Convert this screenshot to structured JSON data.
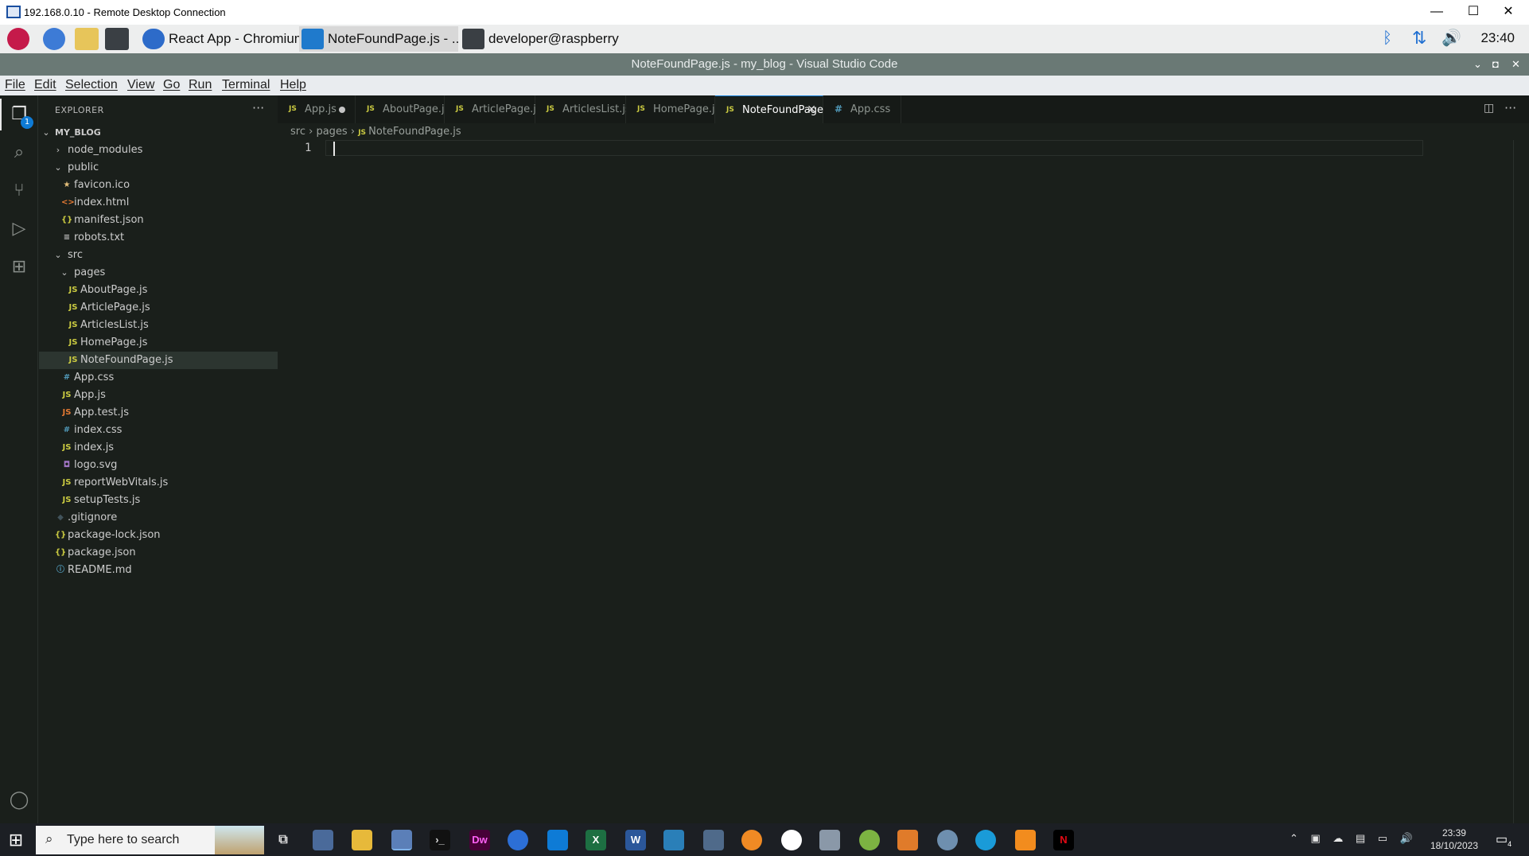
{
  "rdp": {
    "title": "192.168.0.10 - Remote Desktop Connection",
    "minimize": "—",
    "maximize": "☐",
    "close": "✕"
  },
  "pi_taskbar": {
    "tasks": [
      {
        "label": "React App - Chromium",
        "icon": "chromium-icon"
      },
      {
        "label": "NoteFoundPage.js - ...",
        "icon": "vscode-icon"
      },
      {
        "label": "developer@raspberry...",
        "icon": "terminal-icon"
      }
    ],
    "clock": "23:40"
  },
  "vscode": {
    "window_title": "NoteFoundPage.js - my_blog - Visual Studio Code",
    "menu": [
      "File",
      "Edit",
      "Selection",
      "View",
      "Go",
      "Run",
      "Terminal",
      "Help"
    ],
    "explorer_label": "EXPLORER",
    "explorer_more": "···",
    "source_control_badge": "1",
    "project": "MY_BLOG",
    "tree": [
      {
        "label": "node_modules",
        "depth": 1,
        "kind": "folder",
        "open": false
      },
      {
        "label": "public",
        "depth": 1,
        "kind": "folder",
        "open": true
      },
      {
        "label": "favicon.ico",
        "depth": 2,
        "kind": "file",
        "icon": "★",
        "color": "#e5c07b"
      },
      {
        "label": "index.html",
        "depth": 2,
        "kind": "file",
        "icon": "<>",
        "color": "#e37933"
      },
      {
        "label": "manifest.json",
        "depth": 2,
        "kind": "file",
        "icon": "{}",
        "color": "#cbcb41"
      },
      {
        "label": "robots.txt",
        "depth": 2,
        "kind": "file",
        "icon": "≡",
        "color": "#c5c5c5"
      },
      {
        "label": "src",
        "depth": 1,
        "kind": "folder",
        "open": true
      },
      {
        "label": "pages",
        "depth": 2,
        "kind": "folder",
        "open": true
      },
      {
        "label": "AboutPage.js",
        "depth": 3,
        "kind": "file",
        "icon": "JS",
        "color": "#cbcb41"
      },
      {
        "label": "ArticlePage.js",
        "depth": 3,
        "kind": "file",
        "icon": "JS",
        "color": "#cbcb41"
      },
      {
        "label": "ArticlesList.js",
        "depth": 3,
        "kind": "file",
        "icon": "JS",
        "color": "#cbcb41"
      },
      {
        "label": "HomePage.js",
        "depth": 3,
        "kind": "file",
        "icon": "JS",
        "color": "#cbcb41"
      },
      {
        "label": "NoteFoundPage.js",
        "depth": 3,
        "kind": "file",
        "icon": "JS",
        "color": "#cbcb41",
        "selected": true
      },
      {
        "label": "App.css",
        "depth": 2,
        "kind": "file",
        "icon": "#",
        "color": "#519aba"
      },
      {
        "label": "App.js",
        "depth": 2,
        "kind": "file",
        "icon": "JS",
        "color": "#cbcb41"
      },
      {
        "label": "App.test.js",
        "depth": 2,
        "kind": "file",
        "icon": "JS",
        "color": "#e37933"
      },
      {
        "label": "index.css",
        "depth": 2,
        "kind": "file",
        "icon": "#",
        "color": "#519aba"
      },
      {
        "label": "index.js",
        "depth": 2,
        "kind": "file",
        "icon": "JS",
        "color": "#cbcb41"
      },
      {
        "label": "logo.svg",
        "depth": 2,
        "kind": "file",
        "icon": "◘",
        "color": "#a074c4"
      },
      {
        "label": "reportWebVitals.js",
        "depth": 2,
        "kind": "file",
        "icon": "JS",
        "color": "#cbcb41"
      },
      {
        "label": "setupTests.js",
        "depth": 2,
        "kind": "file",
        "icon": "JS",
        "color": "#cbcb41"
      },
      {
        "label": ".gitignore",
        "depth": 1,
        "kind": "file",
        "icon": "◆",
        "color": "#41535b"
      },
      {
        "label": "package-lock.json",
        "depth": 1,
        "kind": "file",
        "icon": "{}",
        "color": "#cbcb41"
      },
      {
        "label": "package.json",
        "depth": 1,
        "kind": "file",
        "icon": "{}",
        "color": "#cbcb41"
      },
      {
        "label": "README.md",
        "depth": 1,
        "kind": "file",
        "icon": "ⓘ",
        "color": "#519aba"
      }
    ],
    "tabs": [
      {
        "label": "App.js",
        "type": "js",
        "dirty": true
      },
      {
        "label": "AboutPage.js",
        "type": "js"
      },
      {
        "label": "ArticlePage.js",
        "type": "js"
      },
      {
        "label": "ArticlesList.js",
        "type": "js"
      },
      {
        "label": "HomePage.js",
        "type": "js"
      },
      {
        "label": "NoteFoundPage.js",
        "type": "js",
        "active": true
      },
      {
        "label": "App.css",
        "type": "css"
      }
    ],
    "breadcrumb": [
      "src",
      "pages",
      "NoteFoundPage.js"
    ],
    "line_numbers": [
      "1"
    ]
  },
  "windows_taskbar": {
    "search_placeholder": "Type here to search",
    "time": "23:39",
    "date": "18/10/2023",
    "notification_count": "4"
  }
}
